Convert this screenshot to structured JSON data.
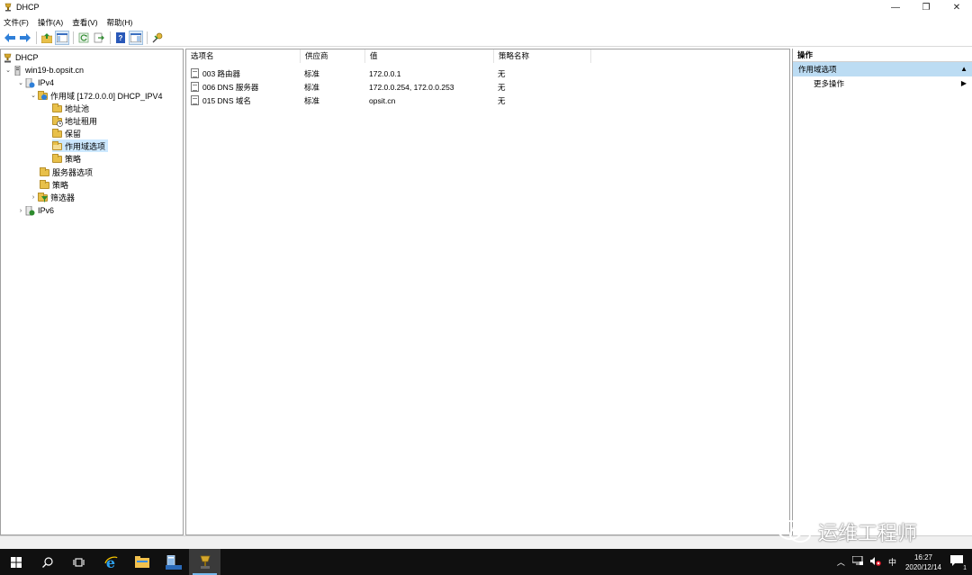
{
  "window": {
    "title": "DHCP",
    "minimize": "—",
    "restore": "❐",
    "close": "✕"
  },
  "menu": [
    "文件(F)",
    "操作(A)",
    "查看(V)",
    "帮助(H)"
  ],
  "toolbar": [
    "back-arrow-icon",
    "forward-arrow-icon",
    "up-folder-icon",
    "show-tree-icon",
    "refresh-icon",
    "export-icon",
    "help-icon",
    "properties-icon",
    "dhcp-action-icon"
  ],
  "tree": [
    {
      "label": "DHCP",
      "icon": "dhcp-icon",
      "level": 0,
      "arrow": ""
    },
    {
      "label": "win19-b.opsit.cn",
      "icon": "server-icon",
      "level": 1,
      "arrow": "⌄"
    },
    {
      "label": "IPv4",
      "icon": "ipv4-icon",
      "level": 2,
      "arrow": "⌄"
    },
    {
      "label": "作用域 [172.0.0.0] DHCP_IPV4",
      "icon": "scope-folder-icon",
      "level": 3,
      "arrow": "⌄"
    },
    {
      "label": "地址池",
      "icon": "folder-icon",
      "level": 4,
      "arrow": ""
    },
    {
      "label": "地址租用",
      "icon": "lease-icon",
      "level": 4,
      "arrow": ""
    },
    {
      "label": "保留",
      "icon": "folder-icon",
      "level": 4,
      "arrow": ""
    },
    {
      "label": "作用域选项",
      "icon": "folder-icon",
      "level": 4,
      "arrow": "",
      "selected": true
    },
    {
      "label": "策略",
      "icon": "folder-icon",
      "level": 4,
      "arrow": ""
    },
    {
      "label": "服务器选项",
      "icon": "folder-icon",
      "level": 3,
      "arrow": ""
    },
    {
      "label": "策略",
      "icon": "folder-icon",
      "level": 3,
      "arrow": ""
    },
    {
      "label": "筛选器",
      "icon": "filter-icon",
      "level": 3,
      "arrow": "›"
    },
    {
      "label": "IPv6",
      "icon": "ipv6-icon",
      "level": 2,
      "arrow": "›"
    }
  ],
  "list": {
    "columns": [
      "选项名",
      "供应商",
      "值",
      "策略名称"
    ],
    "rows": [
      [
        "003 路由器",
        "标准",
        "172.0.0.1",
        "无"
      ],
      [
        "006 DNS 服务器",
        "标准",
        "172.0.0.254, 172.0.0.253",
        "无"
      ],
      [
        "015 DNS 域名",
        "标准",
        "opsit.cn",
        "无"
      ]
    ]
  },
  "actions": {
    "header": "操作",
    "section": "作用域选项",
    "items": [
      "更多操作"
    ]
  },
  "taskbar": {
    "apps": [
      "start-icon",
      "search-icon",
      "task-view-icon",
      "ie-icon",
      "file-explorer-icon",
      "server-manager-icon",
      "dhcp-icon"
    ],
    "tray_lang": "中",
    "time": "16:27",
    "date": "2020/12/14",
    "notifications": "1"
  },
  "watermark": "运维工程师"
}
